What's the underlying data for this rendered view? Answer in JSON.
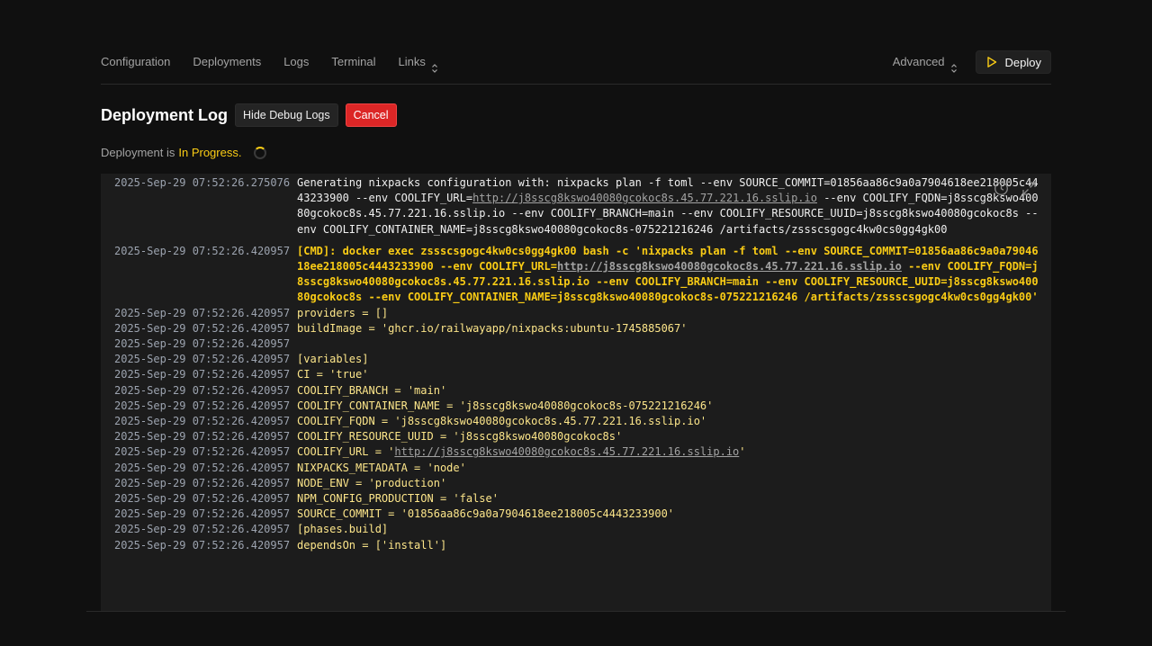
{
  "nav": {
    "items": [
      {
        "label": "Configuration"
      },
      {
        "label": "Deployments"
      },
      {
        "label": "Logs"
      },
      {
        "label": "Terminal"
      },
      {
        "label": "Links"
      }
    ],
    "advanced_label": "Advanced",
    "deploy_label": "Deploy"
  },
  "header": {
    "title": "Deployment Log",
    "hide_debug_label": "Hide Debug Logs",
    "cancel_label": "Cancel"
  },
  "status": {
    "prefix": "Deployment is",
    "state": "In Progress."
  },
  "colors": {
    "accent": "#facc15",
    "cancel": "#dc2626",
    "background": "#101010",
    "log_background": "#1c1c1c"
  },
  "icons": [
    "chevron-updown-icon",
    "play-icon",
    "spinner-icon",
    "history-icon",
    "fullscreen-icon"
  ],
  "log": [
    {
      "ts": "2025-Sep-29 07:52:26.275076",
      "type": "info",
      "parts": [
        {
          "t": "Generating nixpacks configuration with: nixpacks plan -f toml --env SOURCE_COMMIT=01856aa86c9a0a7904618ee218005c4443233900 --env COOLIFY_URL="
        },
        {
          "t": "http://j8sscg8kswo40080gcokoc8s.45.77.221.16.sslip.io",
          "link": true
        },
        {
          "t": " --env COOLIFY_FQDN=j8sscg8kswo40080gcokoc8s.45.77.221.16.sslip.io --env COOLIFY_BRANCH=main --env COOLIFY_RESOURCE_UUID=j8sscg8kswo40080gcokoc8s --env COOLIFY_CONTAINER_NAME=j8sscg8kswo40080gcokoc8s-075221216246 /artifacts/zssscsgogc4kw0cs0gg4gk00"
        }
      ]
    },
    {
      "ts": "2025-Sep-29 07:52:26.420957",
      "type": "cmd",
      "gap": true,
      "parts": [
        {
          "t": "[CMD]: docker exec zssscsgogc4kw0cs0gg4gk00 bash -c 'nixpacks plan -f toml --env SOURCE_COMMIT=01856aa86c9a0a7904618ee218005c4443233900 --env COOLIFY_URL="
        },
        {
          "t": "http://j8sscg8kswo40080gcokoc8s.45.77.221.16.sslip.io",
          "link": true
        },
        {
          "t": " --env COOLIFY_FQDN=j8sscg8kswo40080gcokoc8s.45.77.221.16.sslip.io --env COOLIFY_BRANCH=main --env COOLIFY_RESOURCE_UUID=j8sscg8kswo40080gcokoc8s --env COOLIFY_CONTAINER_NAME=j8sscg8kswo40080gcokoc8s-075221216246 /artifacts/zssscsgogc4kw0cs0gg4gk00'"
        }
      ]
    },
    {
      "ts": "2025-Sep-29 07:52:26.420957",
      "type": "out",
      "parts": [
        {
          "t": "providers = []"
        }
      ]
    },
    {
      "ts": "2025-Sep-29 07:52:26.420957",
      "type": "out",
      "parts": [
        {
          "t": "buildImage = 'ghcr.io/railwayapp/nixpacks:ubuntu-1745885067'"
        }
      ]
    },
    {
      "ts": "2025-Sep-29 07:52:26.420957",
      "type": "out",
      "parts": [
        {
          "t": ""
        }
      ]
    },
    {
      "ts": "2025-Sep-29 07:52:26.420957",
      "type": "out",
      "parts": [
        {
          "t": "[variables]"
        }
      ]
    },
    {
      "ts": "2025-Sep-29 07:52:26.420957",
      "type": "out",
      "parts": [
        {
          "t": "CI = 'true'"
        }
      ]
    },
    {
      "ts": "2025-Sep-29 07:52:26.420957",
      "type": "out",
      "parts": [
        {
          "t": "COOLIFY_BRANCH = 'main'"
        }
      ]
    },
    {
      "ts": "2025-Sep-29 07:52:26.420957",
      "type": "out",
      "parts": [
        {
          "t": "COOLIFY_CONTAINER_NAME = 'j8sscg8kswo40080gcokoc8s-075221216246'"
        }
      ]
    },
    {
      "ts": "2025-Sep-29 07:52:26.420957",
      "type": "out",
      "parts": [
        {
          "t": "COOLIFY_FQDN = 'j8sscg8kswo40080gcokoc8s.45.77.221.16.sslip.io'"
        }
      ]
    },
    {
      "ts": "2025-Sep-29 07:52:26.420957",
      "type": "out",
      "parts": [
        {
          "t": "COOLIFY_RESOURCE_UUID = 'j8sscg8kswo40080gcokoc8s'"
        }
      ]
    },
    {
      "ts": "2025-Sep-29 07:52:26.420957",
      "type": "out",
      "parts": [
        {
          "t": "COOLIFY_URL = '"
        },
        {
          "t": "http://j8sscg8kswo40080gcokoc8s.45.77.221.16.sslip.io",
          "link": true
        },
        {
          "t": "'"
        }
      ]
    },
    {
      "ts": "2025-Sep-29 07:52:26.420957",
      "type": "out",
      "parts": [
        {
          "t": "NIXPACKS_METADATA = 'node'"
        }
      ]
    },
    {
      "ts": "2025-Sep-29 07:52:26.420957",
      "type": "out",
      "parts": [
        {
          "t": "NODE_ENV = 'production'"
        }
      ]
    },
    {
      "ts": "2025-Sep-29 07:52:26.420957",
      "type": "out",
      "parts": [
        {
          "t": "NPM_CONFIG_PRODUCTION = 'false'"
        }
      ]
    },
    {
      "ts": "2025-Sep-29 07:52:26.420957",
      "type": "out",
      "parts": [
        {
          "t": "SOURCE_COMMIT = '01856aa86c9a0a7904618ee218005c4443233900'"
        }
      ]
    },
    {
      "ts": "2025-Sep-29 07:52:26.420957",
      "type": "out",
      "parts": [
        {
          "t": "[phases.build]"
        }
      ]
    },
    {
      "ts": "2025-Sep-29 07:52:26.420957",
      "type": "out",
      "parts": [
        {
          "t": "dependsOn = ['install']"
        }
      ]
    }
  ]
}
